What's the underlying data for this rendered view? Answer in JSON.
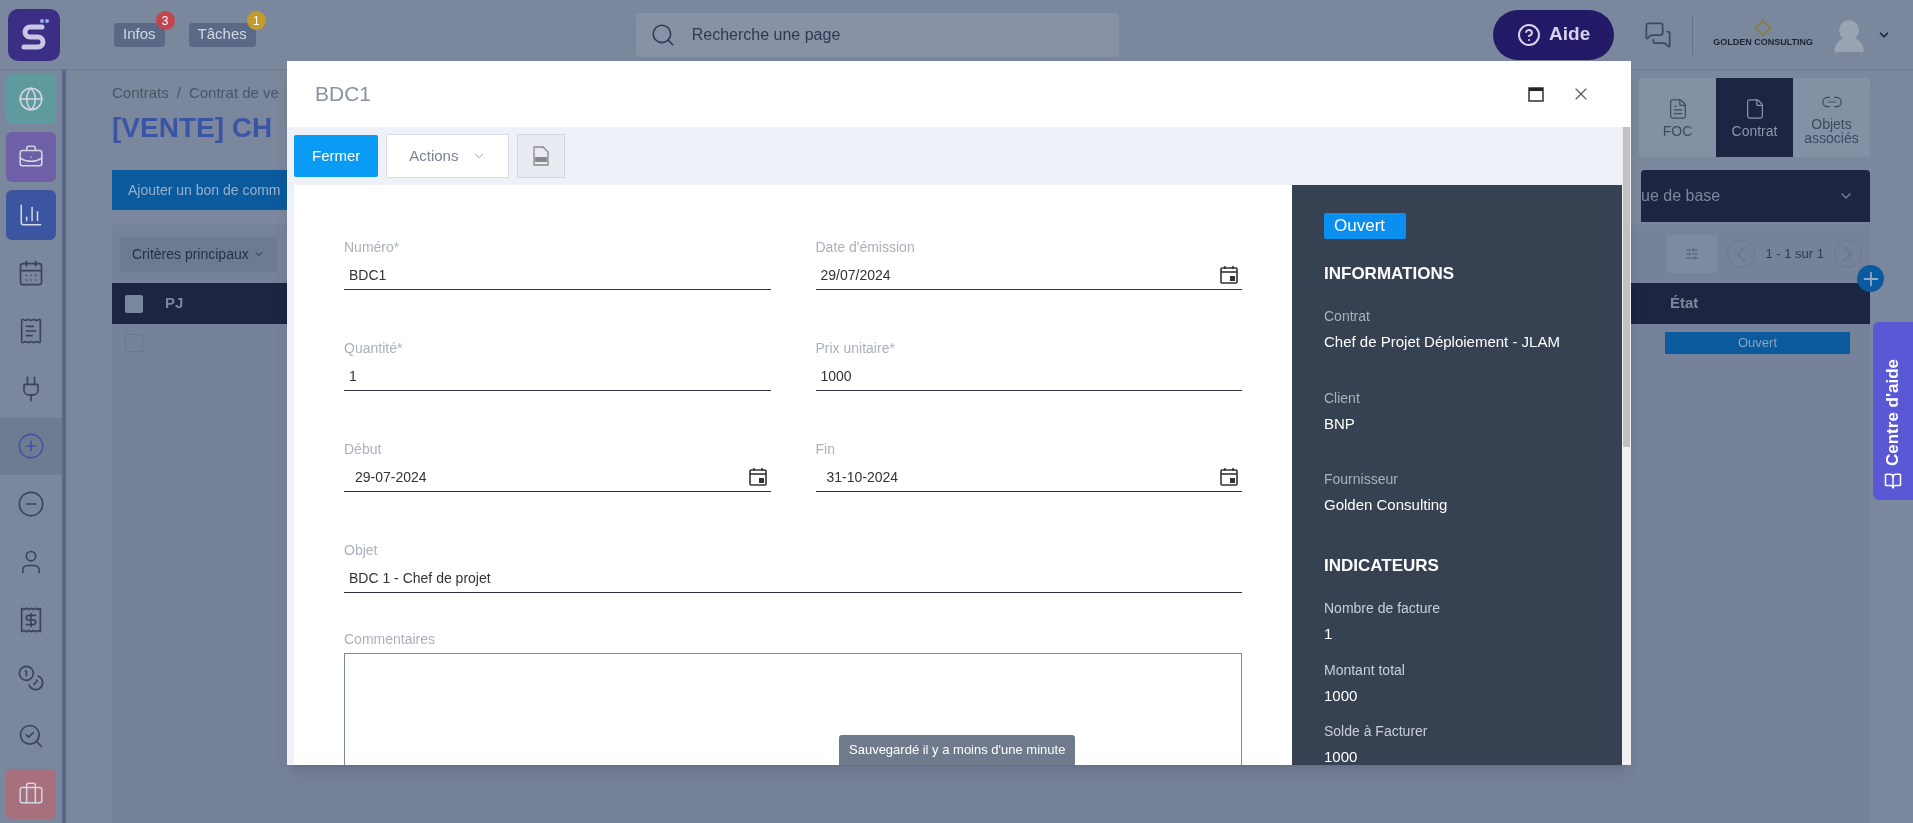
{
  "topbar": {
    "tabs": [
      {
        "label": "Infos",
        "badge": "3",
        "color": "#c2464f"
      },
      {
        "label": "Tâches",
        "badge": "1",
        "color": "#c49a2c"
      }
    ],
    "search": {
      "placeholder": "Recherche une page"
    },
    "help_button": "Aide",
    "company": "GOLDEN CONSULTING"
  },
  "sidebar": {
    "items": [
      {
        "kind": "globe",
        "selected": false
      },
      {
        "kind": "briefcase",
        "selected": false
      },
      {
        "kind": "chart",
        "selected": false
      },
      {
        "kind": "calendar",
        "selected": false
      },
      {
        "kind": "receipts",
        "selected": false
      },
      {
        "kind": "plug",
        "selected": false
      },
      {
        "kind": "income",
        "selected": true
      },
      {
        "kind": "expense",
        "selected": false
      },
      {
        "kind": "person",
        "selected": false
      },
      {
        "kind": "invoice",
        "selected": false
      },
      {
        "kind": "coins",
        "selected": false
      },
      {
        "kind": "analytics",
        "selected": false
      },
      {
        "kind": "briefcase-red",
        "selected": false
      }
    ]
  },
  "page": {
    "breadcrumb": [
      "Contrats",
      "Contrat de ve"
    ],
    "breadcrumb_separator": "/",
    "title": "[VENTE] CH",
    "add_button": "Ajouter un bon de comm",
    "view_select": "ue de base",
    "filter": "Critères principaux",
    "pagination": "1 - 1 sur 1",
    "tabs": [
      {
        "label": "FOC",
        "kind": "doc",
        "selected": false
      },
      {
        "label": "Contrat",
        "kind": "file",
        "selected": true
      },
      {
        "label": "Objets associés",
        "kind": "link",
        "selected": false
      }
    ],
    "table": {
      "columns": [
        "PJ",
        "État"
      ],
      "header_checked": false,
      "rows": [
        {
          "checked": false,
          "status": "Ouvert"
        }
      ]
    }
  },
  "help_center": "Centre d'aide",
  "modal": {
    "title": "BDC1",
    "toolbar": {
      "close_button": "Fermer",
      "actions": "Actions"
    },
    "fields": [
      {
        "label": "Numéro*",
        "value": "BDC1",
        "kind": "text"
      },
      {
        "label": "Date d'émission",
        "value": "29/07/2024",
        "kind": "date"
      },
      {
        "label": "Quantité*",
        "value": "1",
        "kind": "text"
      },
      {
        "label": "Prix unitaire*",
        "value": "1000",
        "kind": "text"
      },
      {
        "label": "Début",
        "value": "29-07-2024",
        "kind": "date"
      },
      {
        "label": "Fin",
        "value": "31-10-2024",
        "kind": "date"
      },
      {
        "label": "Objet",
        "value": "BDC 1 - Chef de projet",
        "kind": "wide"
      }
    ],
    "comment_label": "Commentaires",
    "side": {
      "status": "Ouvert",
      "sections": [
        {
          "title": "INFORMATIONS",
          "kind": "info",
          "items": [
            {
              "label": "Contrat",
              "value": "Chef de Projet Déploiement - JLAM"
            },
            {
              "label": "Client",
              "value": "BNP"
            },
            {
              "label": "Fournisseur",
              "value": "Golden Consulting"
            }
          ]
        },
        {
          "title": "INDICATEURS",
          "kind": "metrics",
          "items": [
            {
              "label": "Nombre de facture",
              "value": "1"
            },
            {
              "label": "Montant total",
              "value": "1000"
            },
            {
              "label": "Solde à Facturer",
              "value": "1000"
            }
          ]
        }
      ]
    },
    "toast": "Sauvegardé il y a moins d'une minute"
  }
}
